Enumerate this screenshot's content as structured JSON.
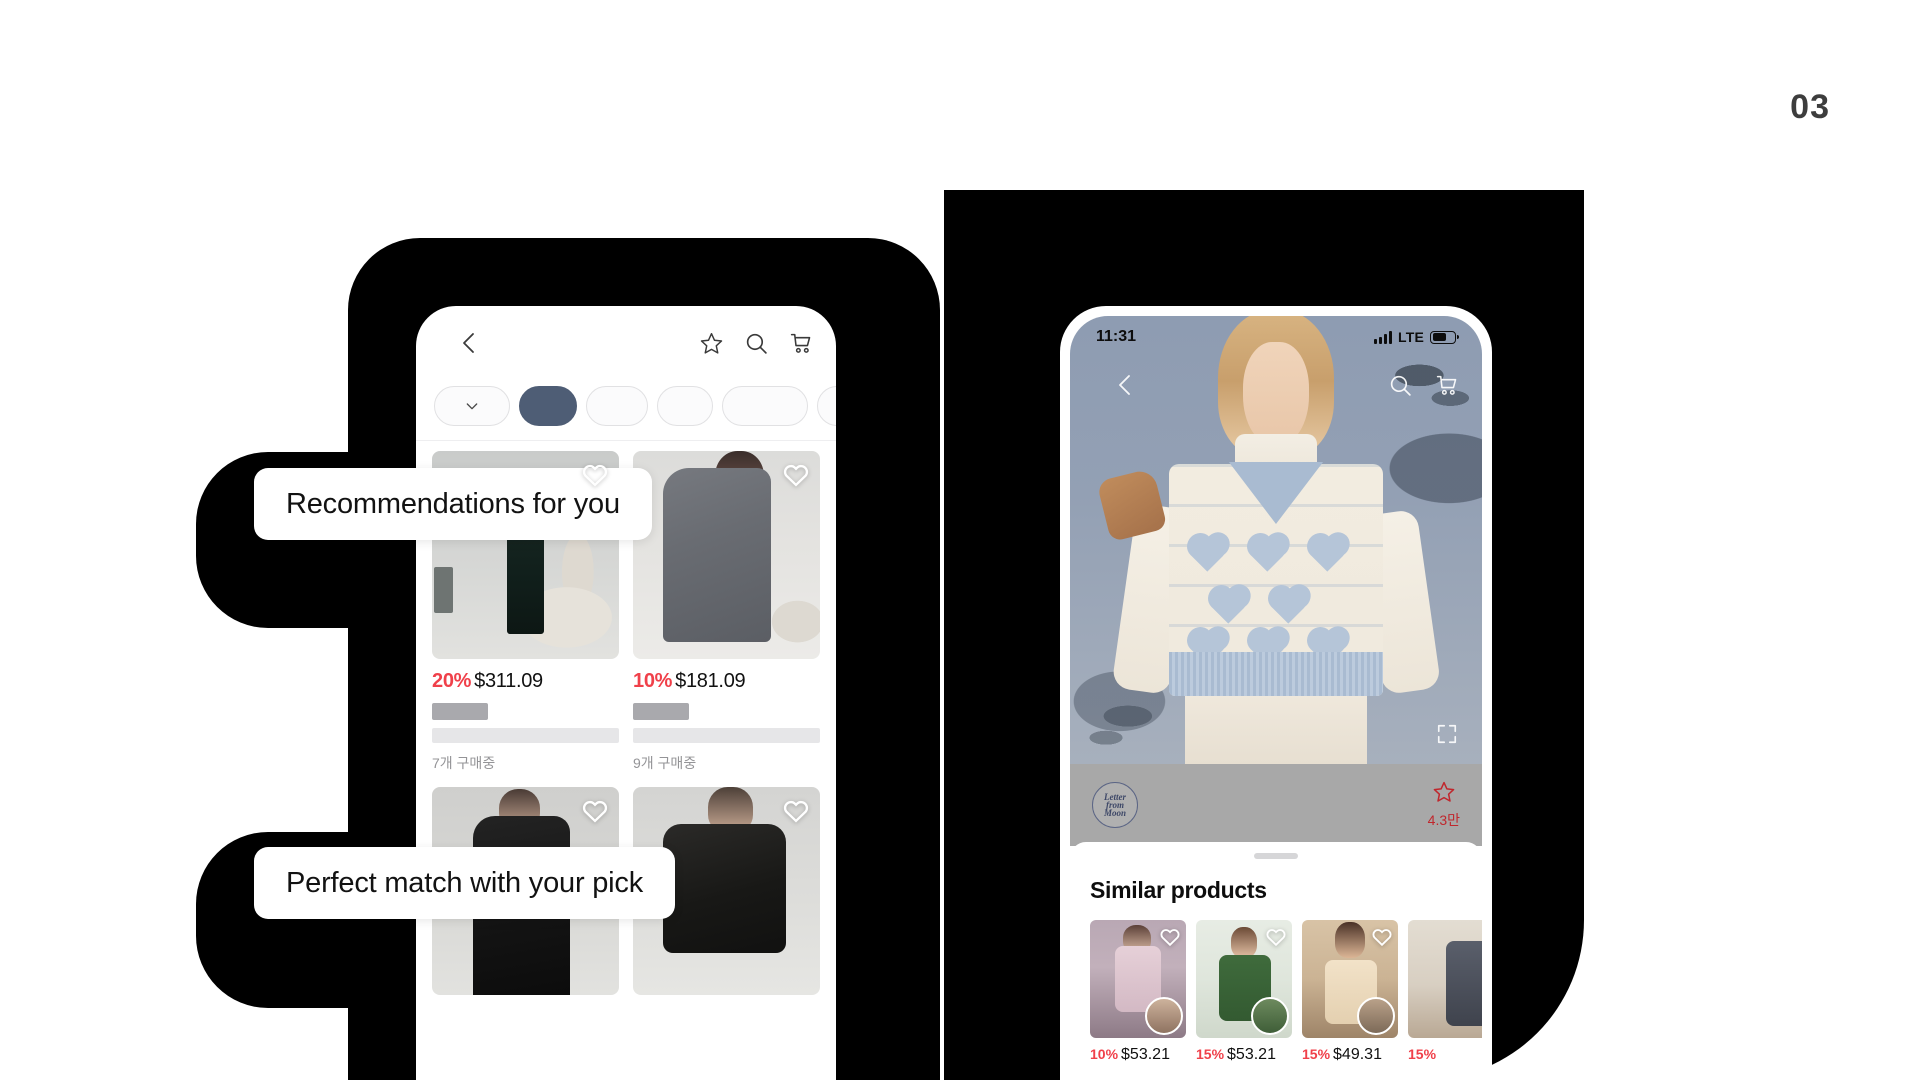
{
  "slide": {
    "page_number": "03"
  },
  "callouts": {
    "first": "Recommendations for you",
    "second": "Perfect match with your pick"
  },
  "colors": {
    "discount_red": "#f0404a",
    "chip_selected": "#4e5d75",
    "rating_red": "#c0272d",
    "backdrop_black": "#000000"
  },
  "left_phone": {
    "header": {
      "back_icon": "chevron-left-icon",
      "star_icon": "star-outline-icon",
      "search_icon": "search-icon",
      "cart_icon": "shopping-cart-icon"
    },
    "filter_chips": [
      {
        "label": "",
        "icon": "chevron-down-icon",
        "selected": false
      },
      {
        "label": "",
        "icon": "",
        "selected": true
      },
      {
        "label": "",
        "icon": "",
        "selected": false
      },
      {
        "label": "",
        "icon": "",
        "selected": false
      },
      {
        "label": "",
        "icon": "",
        "selected": false
      },
      {
        "label": "",
        "icon": "",
        "selected": false
      }
    ],
    "products": [
      {
        "discount": "20%",
        "price": "$311.09",
        "status": "7개 구매중",
        "favorite_icon": "heart-outline-icon"
      },
      {
        "discount": "10%",
        "price": "$181.09",
        "status": "9개 구매중",
        "favorite_icon": "heart-outline-icon"
      },
      {
        "discount": "",
        "price": "",
        "status": "",
        "favorite_icon": "heart-outline-icon"
      },
      {
        "discount": "",
        "price": "",
        "status": "",
        "favorite_icon": "heart-outline-icon"
      }
    ]
  },
  "right_phone": {
    "status_bar": {
      "time": "11:31",
      "network": "LTE",
      "signal_icon": "signal-bars-icon",
      "battery_icon": "battery-icon"
    },
    "nav": {
      "back_icon": "chevron-left-icon",
      "search_icon": "search-icon",
      "cart_icon": "shopping-cart-icon"
    },
    "hero": {
      "expand_icon": "expand-fullscreen-icon"
    },
    "brand_bar": {
      "logo_line1": "Letter",
      "logo_line2": "from",
      "logo_line3": "Moon",
      "rating_icon": "star-outline-icon",
      "rating_value": "4.3만"
    },
    "sheet": {
      "handle": "drag-handle",
      "title": "Similar products",
      "items": [
        {
          "discount": "10%",
          "price": "$53.21",
          "favorite_icon": "heart-outline-icon",
          "avatar": "user-avatar"
        },
        {
          "discount": "15%",
          "price": "$53.21",
          "favorite_icon": "heart-outline-icon",
          "avatar": "user-avatar"
        },
        {
          "discount": "15%",
          "price": "$49.31",
          "favorite_icon": "heart-outline-icon",
          "avatar": "user-avatar"
        },
        {
          "discount": "15%",
          "price": "",
          "favorite_icon": "",
          "avatar": ""
        }
      ]
    }
  }
}
